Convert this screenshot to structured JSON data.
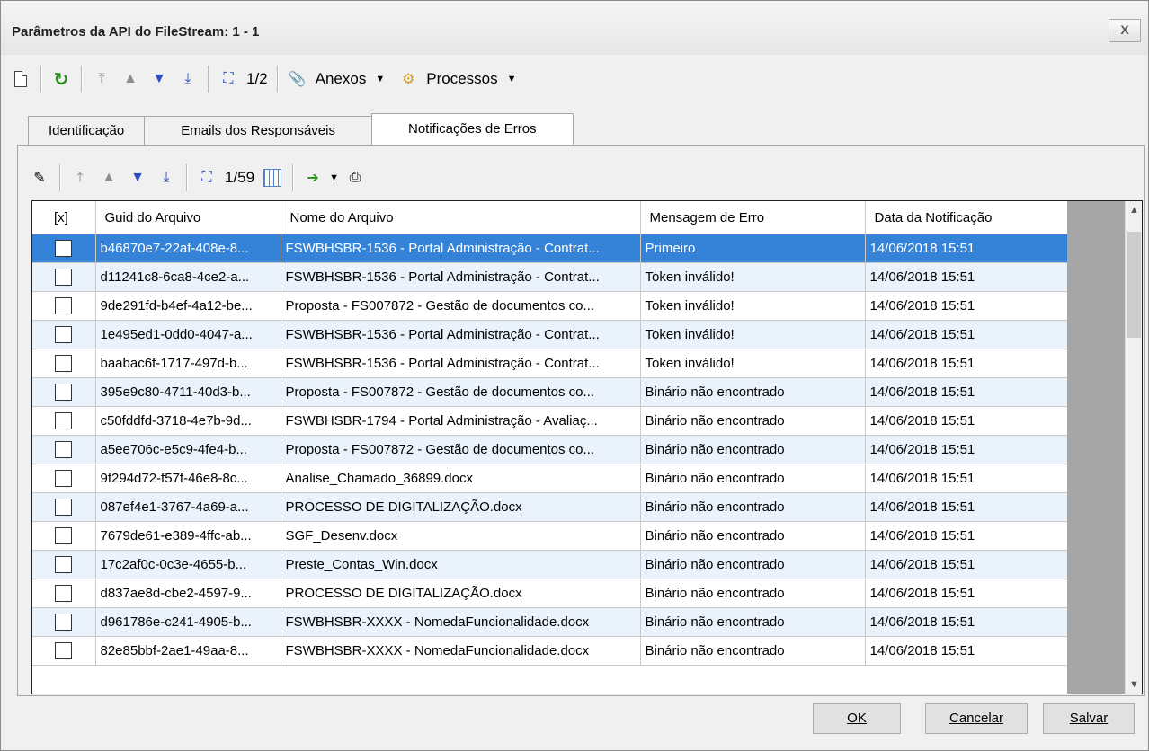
{
  "window": {
    "title": "Parâmetros da API do FileStream: 1 - 1",
    "close_label": "X"
  },
  "toolbar": {
    "record_counter": "1/2",
    "anexos_label": "Anexos",
    "processos_label": "Processos"
  },
  "tabs": [
    {
      "label": "Identificação",
      "active": false
    },
    {
      "label": "Emails dos Responsáveis",
      "active": false
    },
    {
      "label": "Notificações de Erros",
      "active": true
    }
  ],
  "subtoolbar": {
    "record_counter": "1/59"
  },
  "grid": {
    "columns": [
      "[x]",
      "Guid do Arquivo",
      "Nome do Arquivo",
      "Mensagem de Erro",
      "Data da Notificação"
    ],
    "rows": [
      {
        "guid": "b46870e7-22af-408e-8...",
        "nome": "FSWBHSBR-1536 - Portal Administração - Contrat...",
        "msg": "Primeiro",
        "data": "14/06/2018 15:51"
      },
      {
        "guid": "d11241c8-6ca8-4ce2-a...",
        "nome": "FSWBHSBR-1536 - Portal Administração - Contrat...",
        "msg": "Token inválido!",
        "data": "14/06/2018 15:51"
      },
      {
        "guid": "9de291fd-b4ef-4a12-be...",
        "nome": "Proposta - FS007872 - Gestão de documentos co...",
        "msg": "Token inválido!",
        "data": "14/06/2018 15:51"
      },
      {
        "guid": "1e495ed1-0dd0-4047-a...",
        "nome": "FSWBHSBR-1536 - Portal Administração - Contrat...",
        "msg": "Token inválido!",
        "data": "14/06/2018 15:51"
      },
      {
        "guid": "baabac6f-1717-497d-b...",
        "nome": "FSWBHSBR-1536 - Portal Administração - Contrat...",
        "msg": "Token inválido!",
        "data": "14/06/2018 15:51"
      },
      {
        "guid": "395e9c80-4711-40d3-b...",
        "nome": "Proposta - FS007872 - Gestão de documentos co...",
        "msg": "Binário não encontrado",
        "data": "14/06/2018 15:51"
      },
      {
        "guid": "c50fddfd-3718-4e7b-9d...",
        "nome": "FSWBHSBR-1794 - Portal Administração - Avaliaç...",
        "msg": "Binário não encontrado",
        "data": "14/06/2018 15:51"
      },
      {
        "guid": "a5ee706c-e5c9-4fe4-b...",
        "nome": "Proposta - FS007872 - Gestão de documentos co...",
        "msg": "Binário não encontrado",
        "data": "14/06/2018 15:51"
      },
      {
        "guid": "9f294d72-f57f-46e8-8c...",
        "nome": "Analise_Chamado_36899.docx",
        "msg": "Binário não encontrado",
        "data": "14/06/2018 15:51"
      },
      {
        "guid": "087ef4e1-3767-4a69-a...",
        "nome": "PROCESSO DE DIGITALIZAÇÃO.docx",
        "msg": "Binário não encontrado",
        "data": "14/06/2018 15:51"
      },
      {
        "guid": "7679de61-e389-4ffc-ab...",
        "nome": "SGF_Desenv.docx",
        "msg": "Binário não encontrado",
        "data": "14/06/2018 15:51"
      },
      {
        "guid": "17c2af0c-0c3e-4655-b...",
        "nome": "Preste_Contas_Win.docx",
        "msg": "Binário não encontrado",
        "data": "14/06/2018 15:51"
      },
      {
        "guid": "d837ae8d-cbe2-4597-9...",
        "nome": "PROCESSO DE DIGITALIZAÇÃO.docx",
        "msg": "Binário não encontrado",
        "data": "14/06/2018 15:51"
      },
      {
        "guid": "d961786e-c241-4905-b...",
        "nome": "FSWBHSBR-XXXX - NomedaFuncionalidade.docx",
        "msg": "Binário não encontrado",
        "data": "14/06/2018 15:51"
      },
      {
        "guid": "82e85bbf-2ae1-49aa-8...",
        "nome": "FSWBHSBR-XXXX - NomedaFuncionalidade.docx",
        "msg": "Binário não encontrado",
        "data": "14/06/2018 15:51"
      }
    ]
  },
  "buttons": {
    "ok": "OK",
    "cancel": "Cancelar",
    "save": "Salvar"
  },
  "colors": {
    "selection": "#3583d8",
    "alt_row": "#eaf2fb"
  }
}
